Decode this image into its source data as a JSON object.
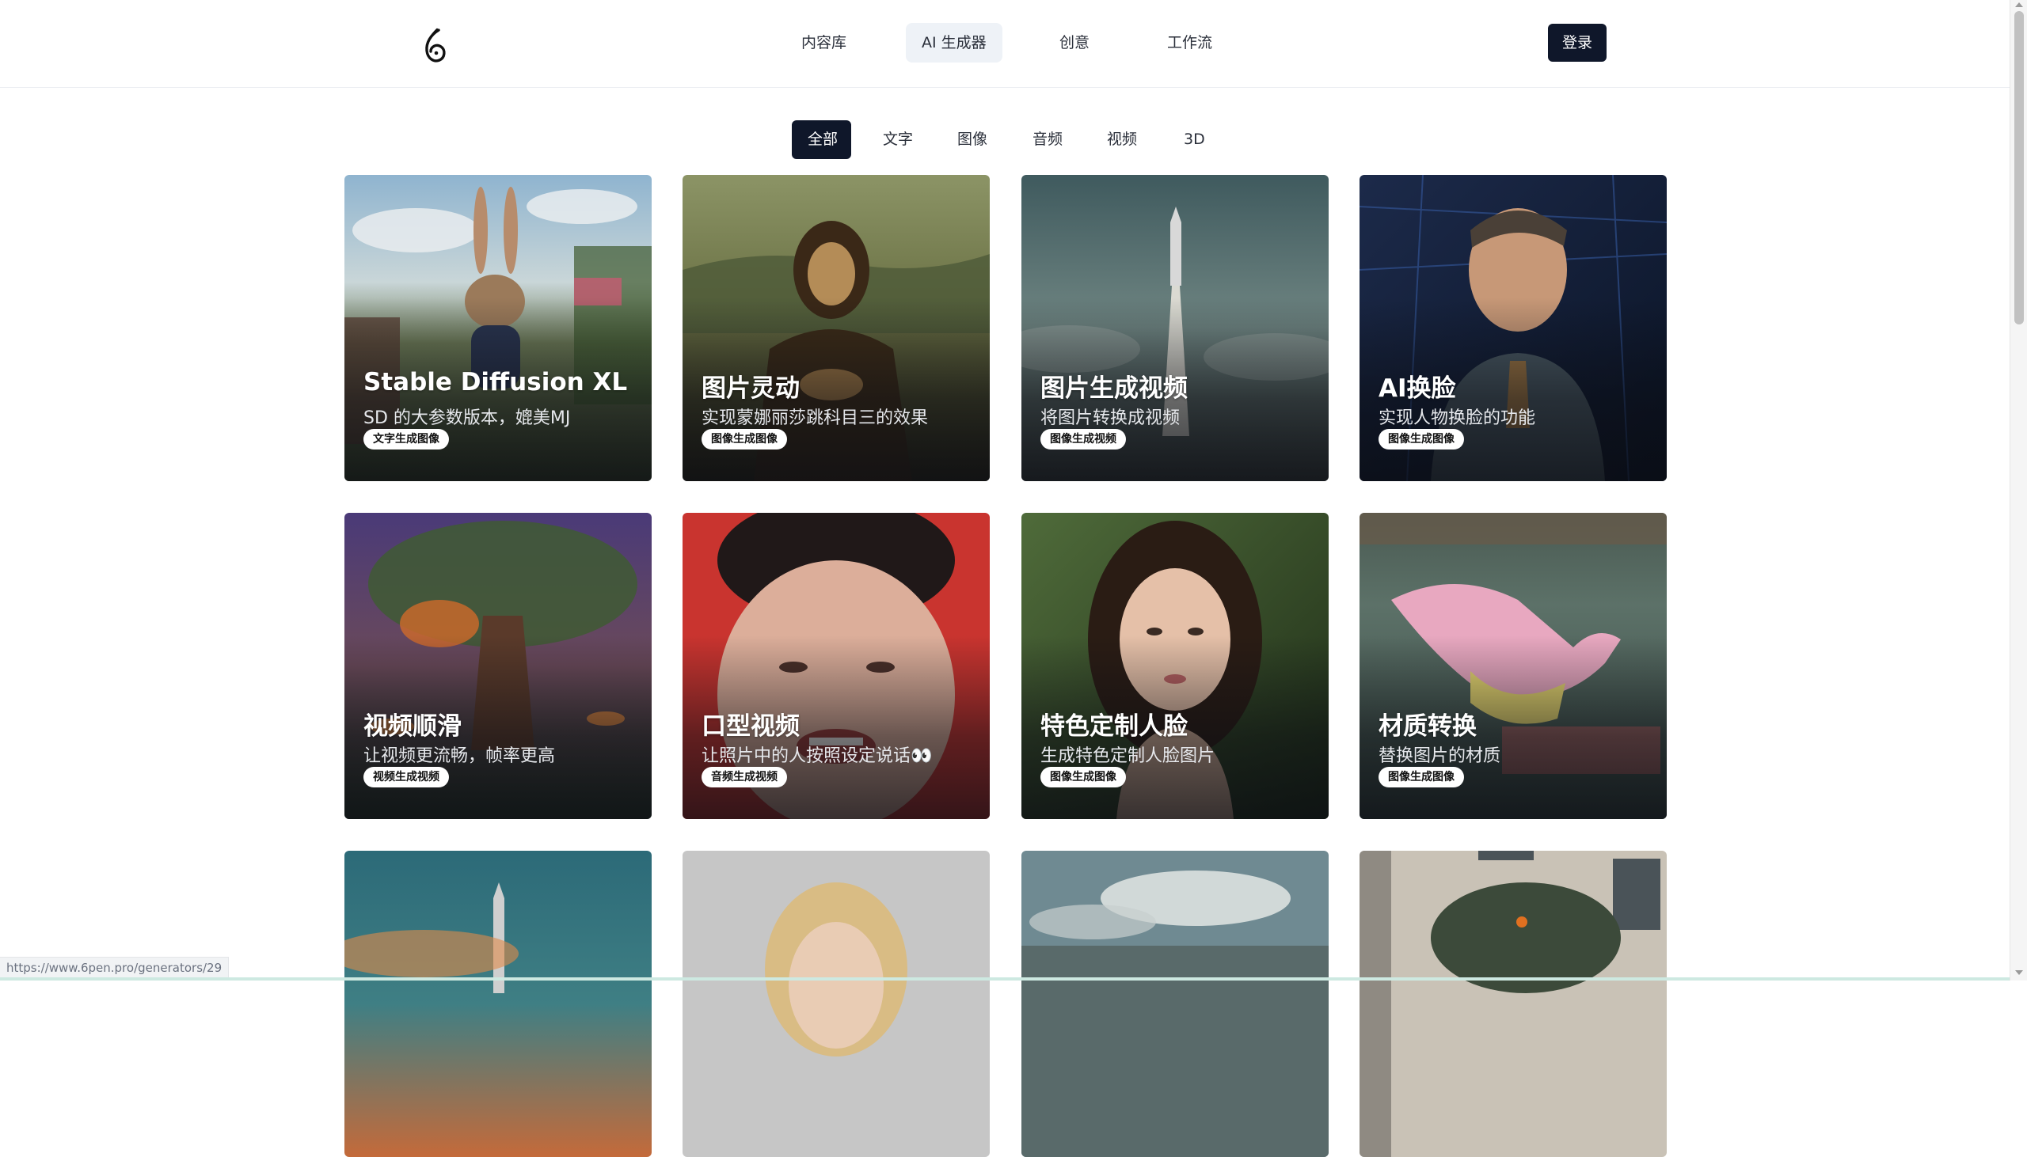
{
  "nav": {
    "items": [
      {
        "label": "内容库",
        "active": false
      },
      {
        "label": "AI 生成器",
        "active": true
      },
      {
        "label": "创意",
        "active": false
      },
      {
        "label": "工作流",
        "active": false
      }
    ],
    "login_label": "登录"
  },
  "filters": [
    {
      "label": "全部",
      "active": true
    },
    {
      "label": "文字",
      "active": false
    },
    {
      "label": "图像",
      "active": false
    },
    {
      "label": "音频",
      "active": false
    },
    {
      "label": "视频",
      "active": false
    },
    {
      "label": "3D",
      "active": false
    }
  ],
  "cards": [
    {
      "title": "Stable Diffusion XL",
      "subtitle": "SD 的大参数版本，媲美MJ",
      "tag": "文字生成图像",
      "icon": "rabbit-illustration"
    },
    {
      "title": "图片灵动",
      "subtitle": "实现蒙娜丽莎跳科目三的效果",
      "tag": "图像生成图像",
      "icon": "mona-lisa-painting"
    },
    {
      "title": "图片生成视频",
      "subtitle": "将图片转换成视频",
      "tag": "图像生成视频",
      "icon": "rocket-launch"
    },
    {
      "title": "AI换脸",
      "subtitle": "实现人物换脸的功能",
      "tag": "图像生成图像",
      "icon": "portrait-man"
    },
    {
      "title": "视频顺滑",
      "subtitle": "让视频更流畅，帧率更高",
      "tag": "视频生成视频",
      "icon": "fantasy-tree"
    },
    {
      "title": "口型视频",
      "subtitle": "让照片中的人按照设定说话👀",
      "tag": "音频生成视频",
      "icon": "talking-face"
    },
    {
      "title": "特色定制人脸",
      "subtitle": "生成特色定制人脸图片",
      "tag": "图像生成图像",
      "icon": "portrait-woman"
    },
    {
      "title": "材质转换",
      "subtitle": "替换图片的材质",
      "tag": "图像生成图像",
      "icon": "bird-sculpture"
    },
    {
      "title": "",
      "subtitle": "",
      "tag": "",
      "icon": "rocket-sunset"
    },
    {
      "title": "",
      "subtitle": "",
      "tag": "",
      "icon": "blonde-woman"
    },
    {
      "title": "",
      "subtitle": "",
      "tag": "",
      "icon": "cloudy-sky"
    },
    {
      "title": "",
      "subtitle": "",
      "tag": "",
      "icon": "dinosaur"
    }
  ],
  "status_url": "https://www.6pen.pro/generators/29"
}
